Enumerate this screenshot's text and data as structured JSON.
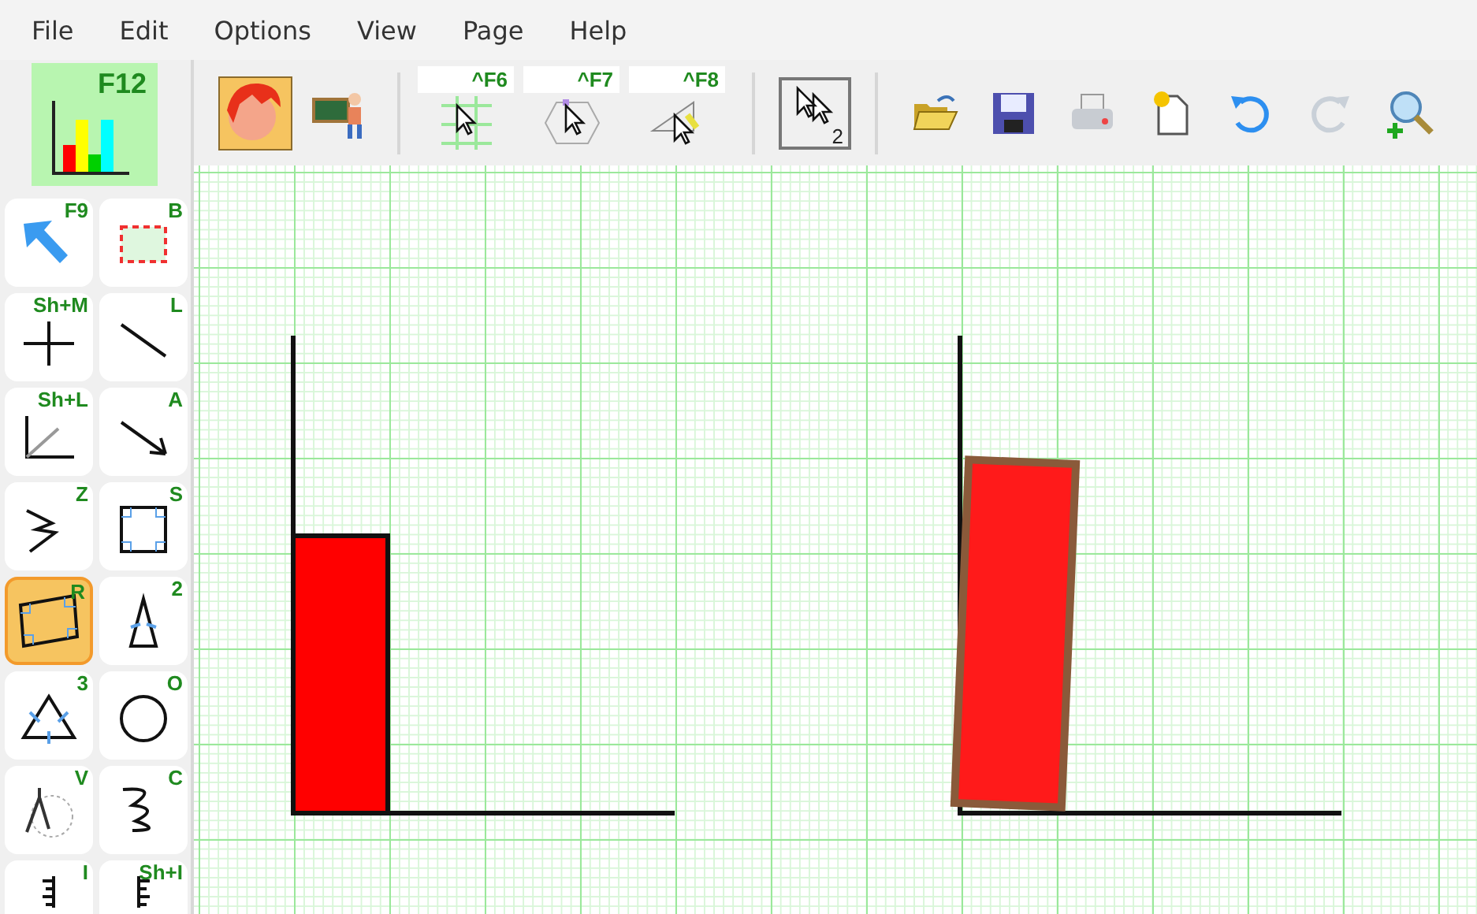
{
  "menu": [
    {
      "label": "File"
    },
    {
      "label": "Edit"
    },
    {
      "label": "Options"
    },
    {
      "label": "View"
    },
    {
      "label": "Page"
    },
    {
      "label": "Help"
    }
  ],
  "chart_tool": {
    "shortcut": "F12"
  },
  "toolbar": [
    {
      "kind": "avatar"
    },
    {
      "kind": "teacher"
    },
    {
      "kind": "separator"
    },
    {
      "kind": "grid-cursor",
      "shortcut": "^F6"
    },
    {
      "kind": "hex-cursor",
      "shortcut": "^F7"
    },
    {
      "kind": "square-cursor",
      "shortcut": "^F8"
    },
    {
      "kind": "separator"
    },
    {
      "kind": "multi-cursor",
      "badge": "2",
      "selected": true
    },
    {
      "kind": "separator"
    },
    {
      "kind": "open"
    },
    {
      "kind": "save"
    },
    {
      "kind": "print"
    },
    {
      "kind": "new"
    },
    {
      "kind": "undo"
    },
    {
      "kind": "redo",
      "disabled": true
    },
    {
      "kind": "zoom"
    }
  ],
  "tools": [
    {
      "kind": "pointer",
      "shortcut": "F9",
      "selected": false
    },
    {
      "kind": "selection",
      "shortcut": "B",
      "selected": false
    },
    {
      "kind": "point",
      "shortcut": "Sh+M",
      "selected": false
    },
    {
      "kind": "segment",
      "shortcut": "L",
      "selected": false
    },
    {
      "kind": "axes",
      "shortcut": "Sh+L",
      "selected": false
    },
    {
      "kind": "vector",
      "shortcut": "A",
      "selected": false
    },
    {
      "kind": "polyline",
      "shortcut": "Z",
      "selected": false
    },
    {
      "kind": "square",
      "shortcut": "S",
      "selected": false
    },
    {
      "kind": "rectangle",
      "shortcut": "R",
      "selected": true
    },
    {
      "kind": "isosceles",
      "shortcut": "2",
      "selected": false
    },
    {
      "kind": "equilateral",
      "shortcut": "3",
      "selected": false
    },
    {
      "kind": "circle",
      "shortcut": "O",
      "selected": false
    },
    {
      "kind": "compass",
      "shortcut": "V",
      "selected": false
    },
    {
      "kind": "curve",
      "shortcut": "C",
      "selected": false
    },
    {
      "kind": "ruler",
      "shortcut": "I",
      "selected": false
    },
    {
      "kind": "ruler-right",
      "shortcut": "Sh+I",
      "selected": false
    }
  ],
  "canvas": {
    "shapes": [
      {
        "kind": "axes"
      },
      {
        "kind": "bar",
        "color": "#ff0000"
      },
      {
        "kind": "axes"
      },
      {
        "kind": "tilted-bar",
        "color": "#ff1a1a"
      }
    ]
  }
}
